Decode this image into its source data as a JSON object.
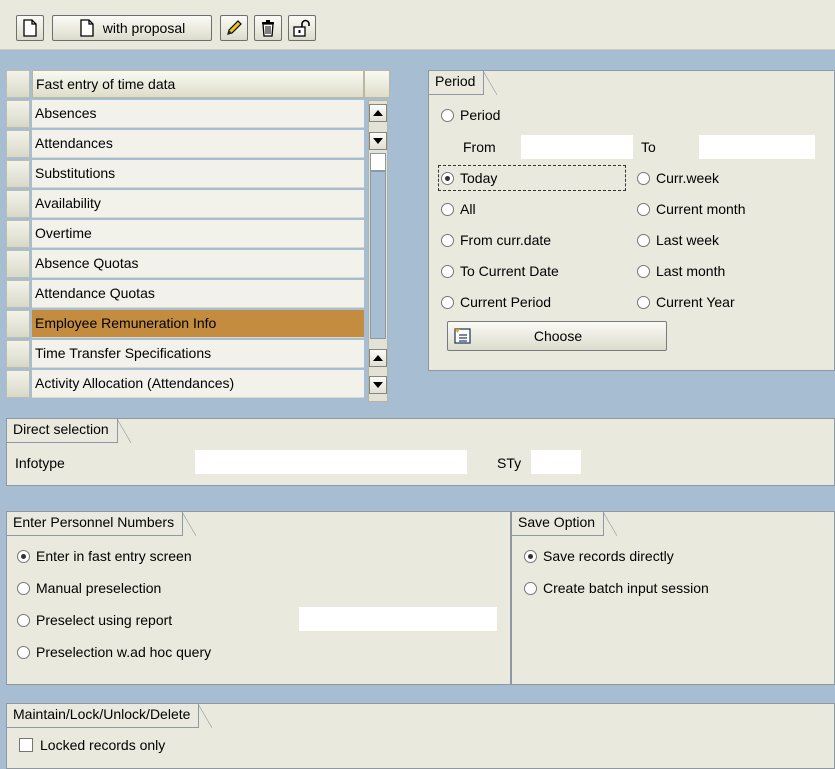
{
  "toolbar": {
    "with_proposal_label": "with proposal"
  },
  "list": {
    "header": "Fast entry of time data",
    "items": [
      "Absences",
      "Attendances",
      "Substitutions",
      "Availability",
      "Overtime",
      "Absence Quotas",
      "Attendance Quotas",
      "Employee Remuneration Info",
      "Time Transfer Specifications",
      "Activity Allocation (Attendances)"
    ],
    "selected_item": "Employee Remuneration Info"
  },
  "period": {
    "title": "Period",
    "period_label": "Period",
    "from_label": "From",
    "to_label": "To",
    "from_value": "",
    "to_value": "",
    "options": {
      "today": "Today",
      "curr_week": "Curr.week",
      "all": "All",
      "current_month": "Current month",
      "from_curr_date": "From curr.date",
      "last_week": "Last week",
      "to_current_date": "To Current Date",
      "last_month": "Last month",
      "current_period": "Current Period",
      "current_year": "Current Year"
    },
    "selected": "Today",
    "choose_label": "Choose"
  },
  "direct_selection": {
    "title": "Direct selection",
    "infotype_label": "Infotype",
    "infotype_value": "",
    "sty_label": "STy",
    "sty_value": ""
  },
  "personnel": {
    "title": "Enter Personnel Numbers",
    "options": {
      "fast_entry": "Enter in fast entry screen",
      "manual": "Manual preselection",
      "report": "Preselect using report",
      "adhoc": "Preselection w.ad hoc query"
    },
    "selected": "Enter in fast entry screen",
    "report_value": ""
  },
  "save_option": {
    "title": "Save Option",
    "options": {
      "direct": "Save records directly",
      "batch": "Create batch input session"
    },
    "selected": "Save records directly"
  },
  "maintain": {
    "title": "Maintain/Lock/Unlock/Delete",
    "locked_only_label": "Locked records only",
    "locked_only_checked": false
  },
  "colors": {
    "background": "#a6bdd2",
    "panel": "#e9e9dd",
    "selected_row": "#c48c3f"
  }
}
